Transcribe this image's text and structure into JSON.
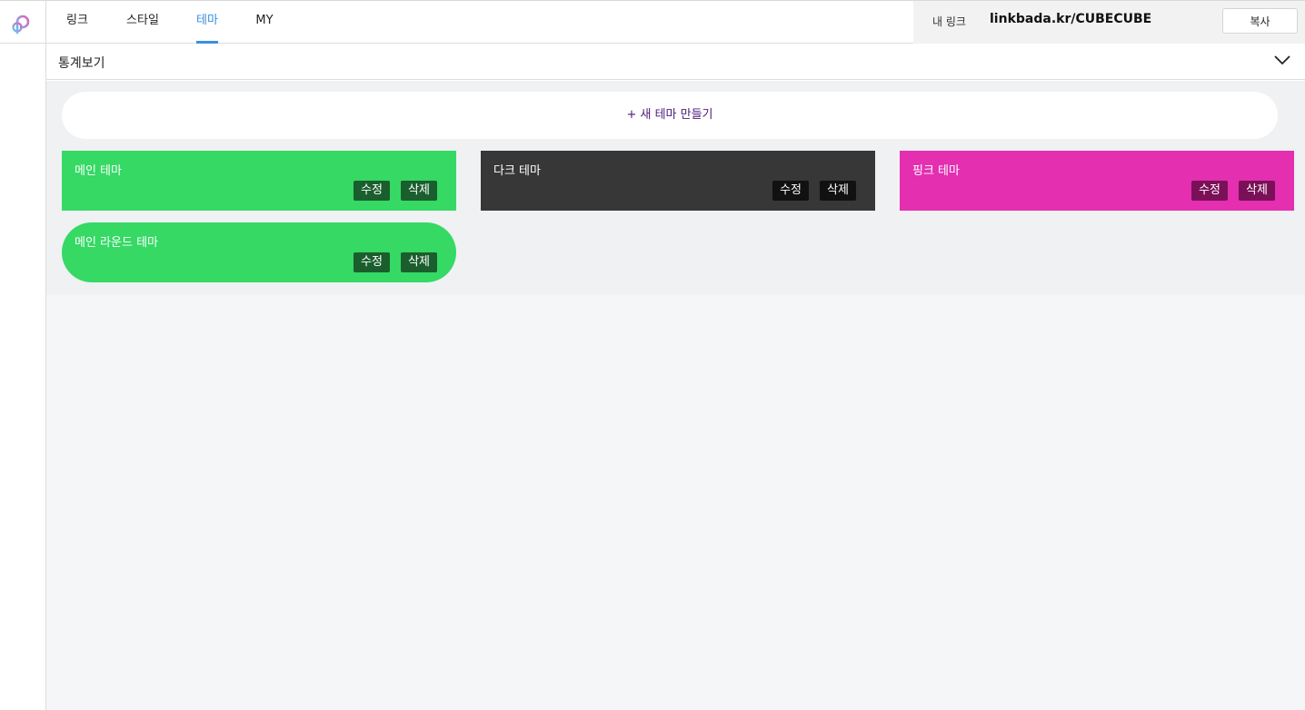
{
  "header": {
    "tabs": [
      {
        "label": "링크"
      },
      {
        "label": "스타일"
      },
      {
        "label": "테마"
      },
      {
        "label": "MY"
      }
    ],
    "active_tab": "테마",
    "mylink_label": "내 링크",
    "mylink_url": "linkbada.kr/CUBECUBE",
    "copy_label": "복사"
  },
  "stats": {
    "label": "통계보기"
  },
  "content": {
    "new_theme_label": "+ 새 테마 만들기",
    "themes": [
      {
        "name": "메인 테마",
        "edit_label": "수정",
        "delete_label": "삭제",
        "color": "#35d964",
        "button_color": "#1b5e2e",
        "rounded": false
      },
      {
        "name": "다크 테마",
        "edit_label": "수정",
        "delete_label": "삭제",
        "color": "#373737",
        "button_color": "#111111",
        "rounded": false
      },
      {
        "name": "핑크 테마",
        "edit_label": "수정",
        "delete_label": "삭제",
        "color": "#e32fb0",
        "button_color": "#7a1058",
        "rounded": false
      },
      {
        "name": "메인 라운드 테마",
        "edit_label": "수정",
        "delete_label": "삭제",
        "color": "#35d964",
        "button_color": "#1b5e2e",
        "rounded": true
      }
    ]
  },
  "colors": {
    "accent": "#3b8fe0"
  }
}
